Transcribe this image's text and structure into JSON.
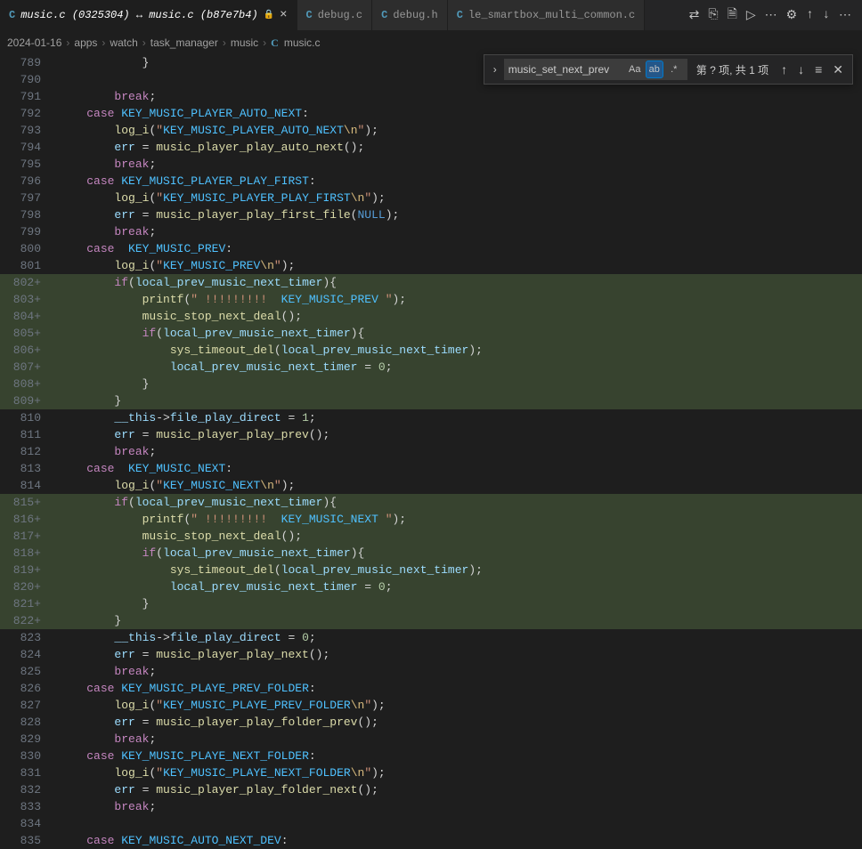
{
  "tabs": [
    {
      "label": "music.c (0325304) ↔ music.c (b87e7b4)",
      "icon": "C",
      "active": true,
      "locked": true,
      "closeable": true
    },
    {
      "label": "debug.c",
      "icon": "C",
      "active": false
    },
    {
      "label": "debug.h",
      "icon": "C",
      "active": false
    },
    {
      "label": "le_smartbox_multi_common.c",
      "icon": "C",
      "active": false
    }
  ],
  "toolbar_icons": [
    "compare-icon",
    "new-file-icon",
    "save-icon",
    "run-icon",
    "more-icon",
    "gear-icon",
    "up-icon",
    "down-icon",
    "overflow-icon"
  ],
  "breadcrumbs": [
    "2024-01-16",
    "apps",
    "watch",
    "task_manager",
    "music"
  ],
  "breadcrumb_file": "music.c",
  "find": {
    "value": "music_set_next_prev",
    "case": "Aa",
    "word": "ab",
    "regex": ".*",
    "status": "第 ? 项, 共 1 项",
    "word_active": true
  },
  "code_lines": [
    {
      "n": "789",
      "t": "            }"
    },
    {
      "n": "790",
      "t": ""
    },
    {
      "n": "791",
      "t": "        break;"
    },
    {
      "n": "792",
      "t": "    case KEY_MUSIC_PLAYER_AUTO_NEXT:"
    },
    {
      "n": "793",
      "t": "        log_i(\"KEY_MUSIC_PLAYER_AUTO_NEXT\\n\");"
    },
    {
      "n": "794",
      "t": "        err = music_player_play_auto_next();"
    },
    {
      "n": "795",
      "t": "        break;"
    },
    {
      "n": "796",
      "t": "    case KEY_MUSIC_PLAYER_PLAY_FIRST:"
    },
    {
      "n": "797",
      "t": "        log_i(\"KEY_MUSIC_PLAYER_PLAY_FIRST\\n\");"
    },
    {
      "n": "798",
      "t": "        err = music_player_play_first_file(NULL);"
    },
    {
      "n": "799",
      "t": "        break;"
    },
    {
      "n": "800",
      "t": "    case  KEY_MUSIC_PREV:"
    },
    {
      "n": "801",
      "t": "        log_i(\"KEY_MUSIC_PREV\\n\");"
    },
    {
      "n": "802+",
      "t": "        if(local_prev_music_next_timer){",
      "added": true
    },
    {
      "n": "803+",
      "t": "            printf(\" !!!!!!!!!  KEY_MUSIC_PREV \");",
      "added": true
    },
    {
      "n": "804+",
      "t": "            music_stop_next_deal();",
      "added": true
    },
    {
      "n": "805+",
      "t": "            if(local_prev_music_next_timer){",
      "added": true
    },
    {
      "n": "806+",
      "t": "                sys_timeout_del(local_prev_music_next_timer);",
      "added": true
    },
    {
      "n": "807+",
      "t": "                local_prev_music_next_timer = 0;",
      "added": true
    },
    {
      "n": "808+",
      "t": "            }",
      "added": true
    },
    {
      "n": "809+",
      "t": "        }",
      "added": true
    },
    {
      "n": "810",
      "t": "        __this->file_play_direct = 1;"
    },
    {
      "n": "811",
      "t": "        err = music_player_play_prev();"
    },
    {
      "n": "812",
      "t": "        break;"
    },
    {
      "n": "813",
      "t": "    case  KEY_MUSIC_NEXT:"
    },
    {
      "n": "814",
      "t": "        log_i(\"KEY_MUSIC_NEXT\\n\");"
    },
    {
      "n": "815+",
      "t": "        if(local_prev_music_next_timer){",
      "added": true
    },
    {
      "n": "816+",
      "t": "            printf(\" !!!!!!!!!  KEY_MUSIC_NEXT \");",
      "added": true
    },
    {
      "n": "817+",
      "t": "            music_stop_next_deal();",
      "added": true
    },
    {
      "n": "818+",
      "t": "            if(local_prev_music_next_timer){",
      "added": true
    },
    {
      "n": "819+",
      "t": "                sys_timeout_del(local_prev_music_next_timer);",
      "added": true
    },
    {
      "n": "820+",
      "t": "                local_prev_music_next_timer = 0;",
      "added": true
    },
    {
      "n": "821+",
      "t": "            }",
      "added": true
    },
    {
      "n": "822+",
      "t": "        }",
      "added": true
    },
    {
      "n": "823",
      "t": "        __this->file_play_direct = 0;"
    },
    {
      "n": "824",
      "t": "        err = music_player_play_next();"
    },
    {
      "n": "825",
      "t": "        break;"
    },
    {
      "n": "826",
      "t": "    case KEY_MUSIC_PLAYE_PREV_FOLDER:"
    },
    {
      "n": "827",
      "t": "        log_i(\"KEY_MUSIC_PLAYE_PREV_FOLDER\\n\");"
    },
    {
      "n": "828",
      "t": "        err = music_player_play_folder_prev();"
    },
    {
      "n": "829",
      "t": "        break;"
    },
    {
      "n": "830",
      "t": "    case KEY_MUSIC_PLAYE_NEXT_FOLDER:"
    },
    {
      "n": "831",
      "t": "        log_i(\"KEY_MUSIC_PLAYE_NEXT_FOLDER\\n\");"
    },
    {
      "n": "832",
      "t": "        err = music_player_play_folder_next();"
    },
    {
      "n": "833",
      "t": "        break;"
    },
    {
      "n": "834",
      "t": ""
    },
    {
      "n": "835",
      "t": "    case KEY_MUSIC_AUTO_NEXT_DEV:"
    }
  ]
}
